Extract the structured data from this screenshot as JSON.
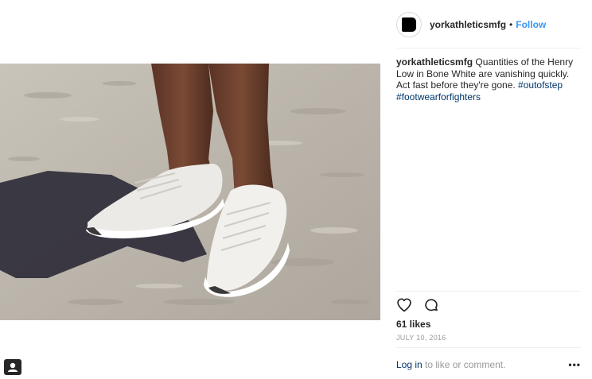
{
  "post": {
    "username": "yorkathleticsmfg",
    "separator": "•",
    "follow_label": "Follow",
    "caption": {
      "author": "yorkathleticsmfg",
      "text": " Quantities of the Henry Low in Bone White are vanishing quickly. Act fast before they're gone. ",
      "hashtags": [
        "#outofstep",
        "#footwearforfighters"
      ]
    },
    "likes": "61 likes",
    "date": "JULY 10, 2016",
    "login_link": "Log in",
    "login_text": " to like or comment.",
    "more_label": "•••"
  },
  "icons": {
    "like": "heart-icon",
    "comment": "comment-icon",
    "tag": "user-tag-icon",
    "more": "more-options-icon"
  },
  "colors": {
    "link_blue": "#3897f0",
    "hashtag_blue": "#003569",
    "muted": "#999999",
    "text": "#262626"
  }
}
